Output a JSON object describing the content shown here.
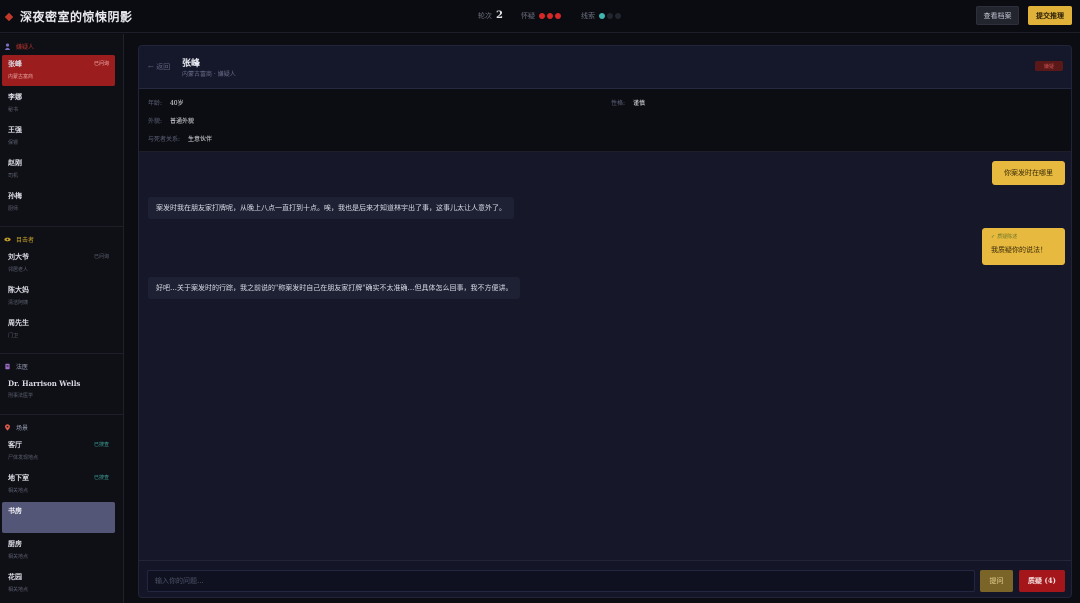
{
  "app": {
    "title": "深夜密室的惊悚阴影"
  },
  "stats": {
    "turns_label": "轮次",
    "turns_value": "2",
    "suspicion_label": "怀疑",
    "suspicion_filled": 3,
    "clues_label": "线索",
    "clues_filled": 1,
    "clues_total": 3
  },
  "toolbar": {
    "file_label": "查看档案",
    "submit_label": "提交推理"
  },
  "sidebar": {
    "suspects": {
      "title": "嫌疑人",
      "items": [
        {
          "name": "张峰",
          "sub": "内蒙古富商",
          "tag": "已问询"
        },
        {
          "name": "李娜",
          "sub": "秘书",
          "tag": ""
        },
        {
          "name": "王强",
          "sub": "保镖",
          "tag": ""
        },
        {
          "name": "赵刚",
          "sub": "司机",
          "tag": ""
        },
        {
          "name": "孙梅",
          "sub": "厨师",
          "tag": ""
        }
      ]
    },
    "witnesses": {
      "title": "目击者",
      "items": [
        {
          "name": "刘大爷",
          "sub": "邻居老人",
          "tag": "已问询"
        },
        {
          "name": "陈大妈",
          "sub": "清洁阿姨",
          "tag": ""
        },
        {
          "name": "周先生",
          "sub": "门卫",
          "tag": ""
        }
      ]
    },
    "forensics": {
      "title": "法医",
      "items": [
        {
          "name": "Dr. Harrison Wells",
          "sub": "刑事法医学"
        }
      ]
    },
    "scenes": {
      "title": "场景",
      "items": [
        {
          "name": "客厅",
          "sub": "尸体发现地点",
          "tag": "已搜查"
        },
        {
          "name": "地下室",
          "sub": "相关地点",
          "tag": "已搜查"
        },
        {
          "name": "书房",
          "sub": "",
          "tag": ""
        },
        {
          "name": "厨房",
          "sub": "相关地点",
          "tag": ""
        },
        {
          "name": "花园",
          "sub": "相关地点",
          "tag": ""
        }
      ]
    }
  },
  "panel": {
    "back_label": "← 返回",
    "name": "张峰",
    "role": "内蒙古富商 · 嫌疑人",
    "badge": "嫌疑",
    "info": {
      "age_label": "年龄:",
      "age_value": "40岁",
      "personality_label": "性格:",
      "personality_value": "谨慎",
      "appearance_label": "外貌:",
      "appearance_value": "普通外貌",
      "relation_label": "与死者关系:",
      "relation_value": "生意伙伴"
    }
  },
  "chat": {
    "messages": [
      {
        "from": "user",
        "text": "你案发时在哪里"
      },
      {
        "from": "npc",
        "text": "案发时我在朋友家打牌呢，从晚上八点一直打到十点。唉，我也是后来才知道林宇出了事，这事儿太让人意外了。"
      },
      {
        "from": "user",
        "tag": "质疑陈述",
        "text": "我质疑你的说法！"
      },
      {
        "from": "npc",
        "text": "好吧…关于案发时的行踪，我之前说的\"称案发时自己在朋友家打牌\"确实不太准确…但具体怎么回事，我不方便讲。"
      }
    ],
    "input_placeholder": "输入你的问题...",
    "ask_label": "提问",
    "accuse_label": "质疑 (4)"
  },
  "colors": {
    "accent_gold": "#e0b23a",
    "danger_red": "#a4161a",
    "suspicion_dot": "#d62828",
    "clue_dot": "#3fb7b0",
    "witness_icon": "#c9a227",
    "forensic_icon": "#9b6cc8",
    "scene_icon": "#e05c4a",
    "scene_tag": "#3aa39a"
  }
}
